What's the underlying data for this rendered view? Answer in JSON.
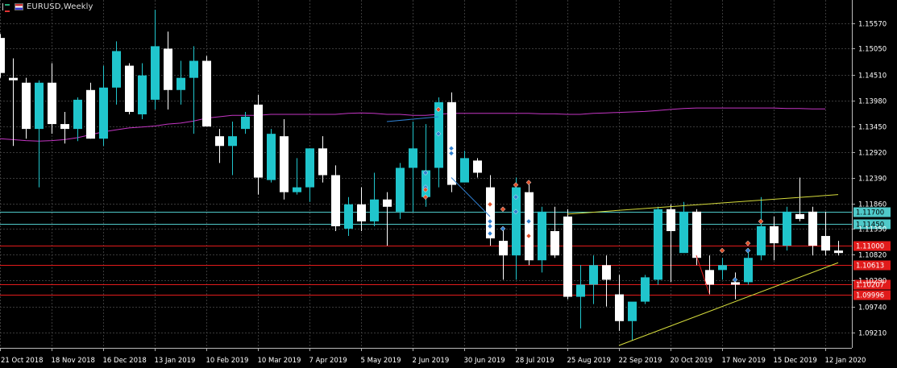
{
  "window": {
    "symbol_label": "EURUSD,Weekly"
  },
  "icons": [
    "lines-icon",
    "flag-icon"
  ],
  "colors": {
    "background": "#000000",
    "grid": "#3a3a3a",
    "bull": "#20c5cc",
    "bear": "#ffffff",
    "ma": "#c436c4",
    "horizontal_red": "#e11b1b",
    "horizontal_teal": "#4fc9c9",
    "trendline": "#d6dc3c",
    "text": "#ffffff"
  },
  "chart_data": {
    "type": "candlestick",
    "symbol": "EURUSD",
    "timeframe": "Weekly",
    "ylim": [
      1.089,
      1.1605
    ],
    "y_ticks": [
      "1.15570",
      "1.15050",
      "1.14510",
      "1.13980",
      "1.13450",
      "1.12920",
      "1.12390",
      "1.11860",
      "1.11350",
      "1.10820",
      "1.10290",
      "1.09740",
      "1.09210"
    ],
    "x_labels": [
      "21 Oct 2018",
      "18 Nov 2018",
      "16 Dec 2018",
      "13 Jan 2019",
      "10 Feb 2019",
      "10 Mar 2019",
      "7 Apr 2019",
      "5 May 2019",
      "2 Jun 2019",
      "30 Jun 2019",
      "28 Jul 2019",
      "25 Aug 2019",
      "22 Sep 2019",
      "20 Oct 2019",
      "17 Nov 2019",
      "15 Dec 2019",
      "12 Jan 2020"
    ],
    "x_label_index": [
      0,
      4,
      8,
      12,
      16,
      20,
      24,
      28,
      32,
      36,
      40,
      44,
      48,
      52,
      56,
      60,
      64
    ],
    "candles": [
      [
        1.1527,
        1.1535,
        1.1445,
        1.1455
      ],
      [
        1.1445,
        1.1485,
        1.1305,
        1.144
      ],
      [
        1.1435,
        1.1445,
        1.132,
        1.134
      ],
      [
        1.134,
        1.144,
        1.122,
        1.1435
      ],
      [
        1.1435,
        1.1475,
        1.133,
        1.135
      ],
      [
        1.135,
        1.1375,
        1.131,
        1.134
      ],
      [
        1.134,
        1.1405,
        1.1315,
        1.14
      ],
      [
        1.142,
        1.1435,
        1.132,
        1.132
      ],
      [
        1.132,
        1.147,
        1.1305,
        1.1425
      ],
      [
        1.1425,
        1.152,
        1.139,
        1.15
      ],
      [
        1.147,
        1.1475,
        1.137,
        1.1375
      ],
      [
        1.137,
        1.1475,
        1.136,
        1.145
      ],
      [
        1.14,
        1.1585,
        1.138,
        1.151
      ],
      [
        1.1505,
        1.154,
        1.138,
        1.142
      ],
      [
        1.142,
        1.148,
        1.139,
        1.1445
      ],
      [
        1.1445,
        1.151,
        1.133,
        1.148
      ],
      [
        1.148,
        1.149,
        1.1345,
        1.1345
      ],
      [
        1.1325,
        1.134,
        1.127,
        1.1305
      ],
      [
        1.1305,
        1.1355,
        1.1245,
        1.1325
      ],
      [
        1.134,
        1.1375,
        1.133,
        1.1365
      ],
      [
        1.139,
        1.141,
        1.1205,
        1.124
      ],
      [
        1.1235,
        1.134,
        1.123,
        1.133
      ],
      [
        1.1325,
        1.136,
        1.1195,
        1.121
      ],
      [
        1.121,
        1.128,
        1.1205,
        1.122
      ],
      [
        1.122,
        1.13,
        1.119,
        1.13
      ],
      [
        1.13,
        1.1325,
        1.123,
        1.1245
      ],
      [
        1.1245,
        1.1265,
        1.113,
        1.114
      ],
      [
        1.1135,
        1.12,
        1.112,
        1.1185
      ],
      [
        1.1185,
        1.122,
        1.113,
        1.115
      ],
      [
        1.115,
        1.125,
        1.114,
        1.1195
      ],
      [
        1.1195,
        1.121,
        1.11,
        1.118
      ],
      [
        1.117,
        1.127,
        1.1155,
        1.126
      ],
      [
        1.126,
        1.1355,
        1.117,
        1.13
      ],
      [
        1.12,
        1.135,
        1.118,
        1.1255
      ],
      [
        1.126,
        1.1405,
        1.122,
        1.1395
      ],
      [
        1.1395,
        1.1415,
        1.121,
        1.1225
      ],
      [
        1.123,
        1.1295,
        1.123,
        1.128
      ],
      [
        1.1275,
        1.128,
        1.124,
        1.125
      ],
      [
        1.122,
        1.1245,
        1.11,
        1.1115
      ],
      [
        1.111,
        1.1135,
        1.103,
        1.108
      ],
      [
        1.108,
        1.124,
        1.103,
        1.122
      ],
      [
        1.121,
        1.123,
        1.106,
        1.107
      ],
      [
        1.107,
        1.118,
        1.1045,
        1.117
      ],
      [
        1.113,
        1.118,
        1.1075,
        1.108
      ],
      [
        1.116,
        1.1175,
        1.099,
        1.0995
      ],
      [
        1.0995,
        1.106,
        1.093,
        1.102
      ],
      [
        1.102,
        1.108,
        1.098,
        1.106
      ],
      [
        1.106,
        1.108,
        1.0975,
        1.103
      ],
      [
        1.1,
        1.104,
        1.0925,
        1.0945
      ],
      [
        1.0945,
        1.098,
        1.0905,
        1.0985
      ],
      [
        1.0985,
        1.104,
        1.098,
        1.1035
      ],
      [
        1.103,
        1.118,
        1.102,
        1.1175
      ],
      [
        1.1175,
        1.1185,
        1.1025,
        1.113
      ],
      [
        1.1085,
        1.119,
        1.1085,
        1.117
      ],
      [
        1.117,
        1.1175,
        1.106,
        1.1075
      ],
      [
        1.105,
        1.108,
        1.1,
        1.102
      ],
      [
        1.105,
        1.1075,
        1.103,
        1.106
      ],
      [
        1.1025,
        1.1045,
        1.099,
        1.102
      ],
      [
        1.1025,
        1.1095,
        1.102,
        1.1075
      ],
      [
        1.108,
        1.12,
        1.107,
        1.114
      ],
      [
        1.114,
        1.116,
        1.107,
        1.1105
      ],
      [
        1.11,
        1.118,
        1.109,
        1.117
      ],
      [
        1.1165,
        1.124,
        1.115,
        1.1155
      ],
      [
        1.117,
        1.118,
        1.108,
        1.11
      ],
      [
        1.112,
        1.117,
        1.108,
        1.109
      ],
      [
        1.109,
        1.111,
        1.108,
        1.1085
      ]
    ],
    "moving_average": [
      1.132,
      1.1318,
      1.1316,
      1.1315,
      1.1316,
      1.1318,
      1.1322,
      1.1328,
      1.1334,
      1.1338,
      1.1342,
      1.1344,
      1.1346,
      1.135,
      1.1352,
      1.1356,
      1.1362,
      1.1365,
      1.1368,
      1.1368,
      1.1368,
      1.137,
      1.137,
      1.137,
      1.137,
      1.137,
      1.137,
      1.1372,
      1.1373,
      1.1372,
      1.137,
      1.137,
      1.1368,
      1.1368,
      1.137,
      1.1372,
      1.1372,
      1.1372,
      1.1372,
      1.1372,
      1.1372,
      1.1372,
      1.1371,
      1.1371,
      1.137,
      1.137,
      1.1372,
      1.1373,
      1.1374,
      1.1375,
      1.1376,
      1.1378,
      1.138,
      1.1382,
      1.1383,
      1.1383,
      1.1383,
      1.1383,
      1.1383,
      1.1383,
      1.1383,
      1.1382,
      1.1382,
      1.1381,
      1.1381
    ],
    "horizontal_lines": [
      {
        "price": 1.117,
        "label": "1.11700",
        "color": "teal"
      },
      {
        "price": 1.1145,
        "label": "1.11450",
        "color": "teal"
      },
      {
        "price": 1.11,
        "label": "1.11000",
        "color": "red"
      },
      {
        "price": 1.10613,
        "label": "1.10613",
        "color": "red"
      },
      {
        "price": 1.10207,
        "label": "1.10207",
        "color": "red"
      },
      {
        "price": 1.09996,
        "label": "1.09996",
        "color": "red"
      }
    ],
    "trendlines": [
      {
        "from": [
          44,
          1.1165
        ],
        "to": [
          65,
          1.1205
        ],
        "color": "yellow"
      },
      {
        "from": [
          48,
          1.0895
        ],
        "to": [
          65,
          1.1065
        ],
        "color": "yellow"
      },
      {
        "from": [
          54,
          1.108
        ],
        "to": [
          55,
          1.1002
        ],
        "color": "red"
      },
      {
        "from": [
          30,
          1.1355
        ],
        "to": [
          34,
          1.1365
        ],
        "color": "blue"
      },
      {
        "from": [
          35,
          1.124
        ],
        "to": [
          38,
          1.116
        ],
        "color": "blue"
      }
    ],
    "markers": {
      "blue_up": [
        [
          33,
          1.125
        ],
        [
          33,
          1.122
        ],
        [
          34,
          1.133
        ],
        [
          35,
          1.13
        ],
        [
          35,
          1.129
        ],
        [
          38,
          1.115
        ],
        [
          38,
          1.114
        ],
        [
          38,
          1.1125
        ],
        [
          39,
          1.1135
        ],
        [
          40,
          1.12
        ],
        [
          40,
          1.117
        ],
        [
          41,
          1.115
        ],
        [
          57,
          1.103
        ],
        [
          58,
          1.109
        ]
      ],
      "red_down": [
        [
          33,
          1.12
        ],
        [
          33,
          1.1215
        ],
        [
          34,
          1.138
        ],
        [
          38,
          1.1185
        ],
        [
          39,
          1.1175
        ],
        [
          40,
          1.1225
        ],
        [
          41,
          1.123
        ],
        [
          41,
          1.112
        ],
        [
          56,
          1.109
        ],
        [
          58,
          1.1105
        ],
        [
          59,
          1.115
        ]
      ]
    },
    "grid": true,
    "price_axis": "right"
  }
}
